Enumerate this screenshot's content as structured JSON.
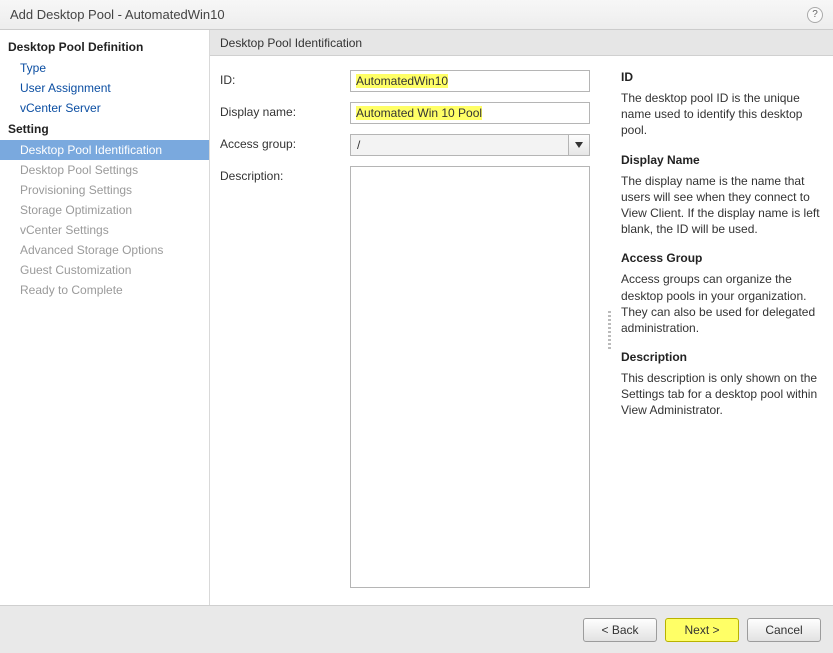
{
  "titlebar": {
    "title": "Add Desktop Pool - AutomatedWin10"
  },
  "sidebar": {
    "section1_label": "Desktop Pool Definition",
    "section1_items": [
      "Type",
      "User Assignment",
      "vCenter Server"
    ],
    "section2_label": "Setting",
    "section2_items": [
      "Desktop Pool Identification",
      "Desktop Pool Settings",
      "Provisioning Settings",
      "Storage Optimization",
      "vCenter Settings",
      "Advanced Storage Options",
      "Guest Customization",
      "Ready to Complete"
    ],
    "selected": "Desktop Pool Identification"
  },
  "content": {
    "header": "Desktop Pool Identification",
    "form": {
      "id_label": "ID:",
      "id_value": "AutomatedWin10",
      "displayname_label": "Display name:",
      "displayname_value": "Automated Win 10 Pool",
      "accessgroup_label": "Access group:",
      "accessgroup_value": "/",
      "description_label": "Description:",
      "description_value": ""
    }
  },
  "help": {
    "h_id": "ID",
    "p_id": "The desktop pool ID is the unique name used to identify this desktop pool.",
    "h_dn": "Display Name",
    "p_dn": "The display name is the name that users will see when they connect to View Client. If the display name is left blank, the ID will be used.",
    "h_ag": "Access Group",
    "p_ag": "Access groups can organize the desktop pools in your organization. They can also be used for delegated administration.",
    "h_desc": "Description",
    "p_desc": "This description is only shown on the Settings tab for a desktop pool within View Administrator."
  },
  "footer": {
    "back": "< Back",
    "next": "Next >",
    "cancel": "Cancel"
  }
}
